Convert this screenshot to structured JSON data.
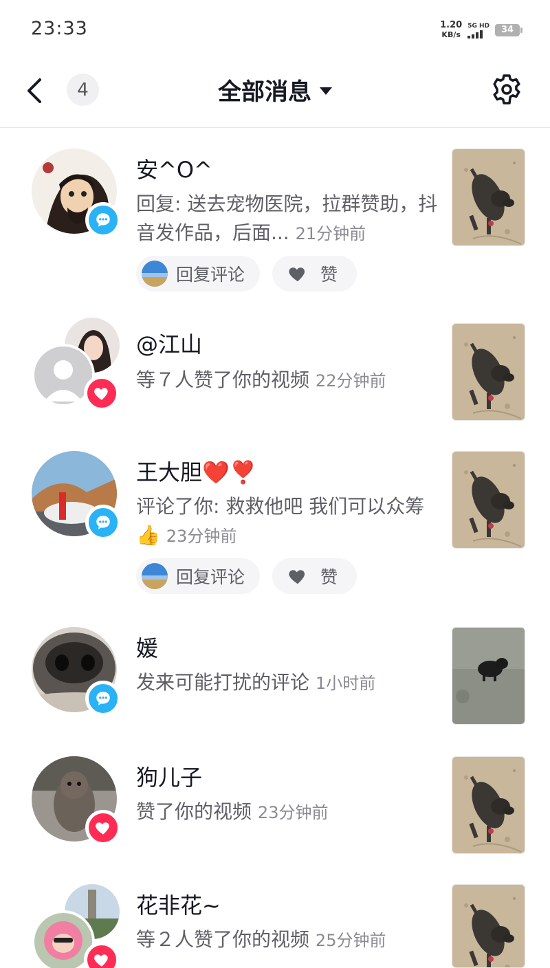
{
  "status_bar": {
    "time": "23:33",
    "net_speed_value": "1.20",
    "net_speed_unit": "KB/s",
    "signal_label": "5G HD",
    "battery": "34"
  },
  "header": {
    "unread_count": "4",
    "title": "全部消息"
  },
  "messages": [
    {
      "name": "安^O^",
      "body": "回复: 送去宠物医院，拉群赞助，抖音发作品，后面...",
      "time": "21分钟前",
      "type": "comment",
      "reply_label": "回复评论",
      "like_label": "赞"
    },
    {
      "name": "@江山",
      "body": "等７人赞了你的视频",
      "time": "22分钟前",
      "type": "like"
    },
    {
      "name": "王大胆❤️❣️",
      "body": "评论了你: 救救他吧 我们可以众筹👍",
      "time": "23分钟前",
      "type": "comment",
      "reply_label": "回复评论",
      "like_label": "赞"
    },
    {
      "name": "媛",
      "body": "发来可能打扰的评论",
      "time": "1小时前",
      "type": "comment"
    },
    {
      "name": "狗儿子",
      "body": "赞了你的视频",
      "time": "23分钟前",
      "type": "like"
    },
    {
      "name": "花非花~",
      "body": "等２人赞了你的视频",
      "time": "25分钟前",
      "type": "like"
    }
  ],
  "colors": {
    "comment_badge": "#2ab2f6",
    "like_badge": "#fe2c55",
    "text_primary": "#161823",
    "text_secondary": "#5f6066"
  }
}
